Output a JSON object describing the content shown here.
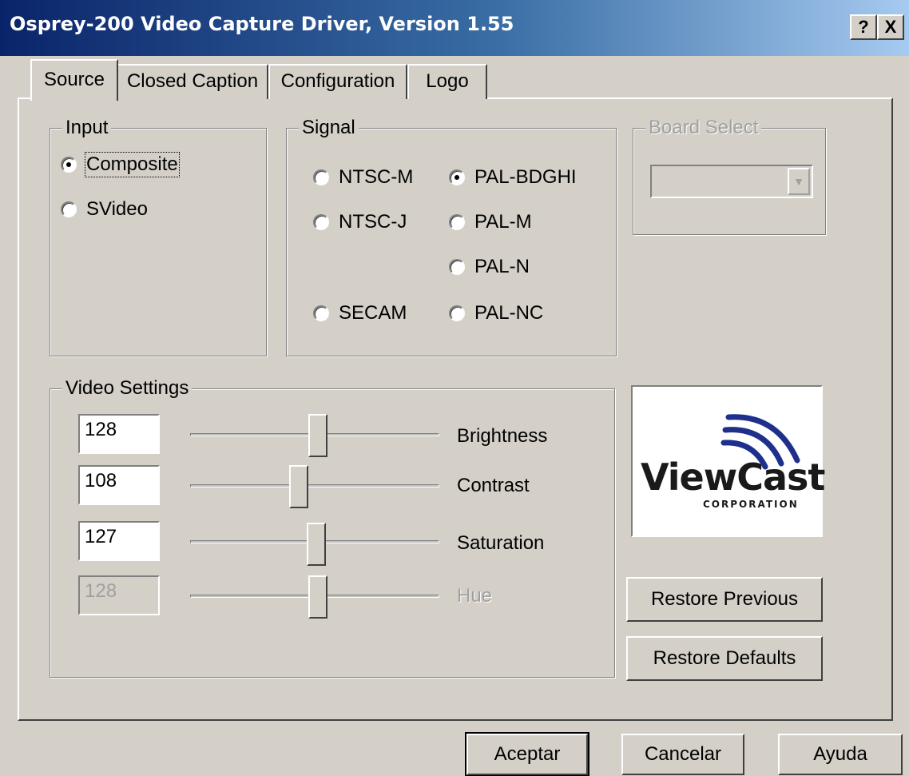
{
  "window": {
    "title": "Osprey-200 Video Capture Driver, Version 1.55",
    "help_glyph": "?",
    "close_glyph": "X"
  },
  "tabs": [
    {
      "label": "Source",
      "active": true
    },
    {
      "label": "Closed Caption",
      "active": false
    },
    {
      "label": "Configuration",
      "active": false
    },
    {
      "label": "Logo",
      "active": false
    }
  ],
  "input_group": {
    "legend": "Input",
    "options": [
      {
        "label": "Composite",
        "selected": true
      },
      {
        "label": "SVideo",
        "selected": false
      }
    ]
  },
  "signal_group": {
    "legend": "Signal",
    "options": [
      {
        "label": "NTSC-M",
        "selected": false
      },
      {
        "label": "PAL-BDGHI",
        "selected": true
      },
      {
        "label": "NTSC-J",
        "selected": false
      },
      {
        "label": "PAL-M",
        "selected": false
      },
      {
        "label": "PAL-N",
        "selected": false
      },
      {
        "label": "SECAM",
        "selected": false
      },
      {
        "label": "PAL-NC",
        "selected": false
      }
    ]
  },
  "board_select": {
    "legend": "Board Select",
    "value": "",
    "enabled": false
  },
  "video_settings": {
    "legend": "Video Settings",
    "rows": [
      {
        "value": "128",
        "label": "Brightness",
        "enabled": true
      },
      {
        "value": "108",
        "label": "Contrast",
        "enabled": true
      },
      {
        "value": "127",
        "label": "Saturation",
        "enabled": true
      },
      {
        "value": "128",
        "label": "Hue",
        "enabled": false
      }
    ]
  },
  "logo": {
    "word": "ViewCast",
    "subword": "CORPORATION",
    "color_dark": "#1a1a1a",
    "color_arc": "#1e2f8c"
  },
  "side_buttons": {
    "restore_previous": "Restore Previous",
    "restore_defaults": "Restore Defaults"
  },
  "footer_buttons": {
    "accept": "Aceptar",
    "cancel": "Cancelar",
    "help": "Ayuda"
  },
  "colors": {
    "title_gradient_start": "#0a246a",
    "title_gradient_end": "#a6caf0",
    "face": "#d4d0c8"
  }
}
